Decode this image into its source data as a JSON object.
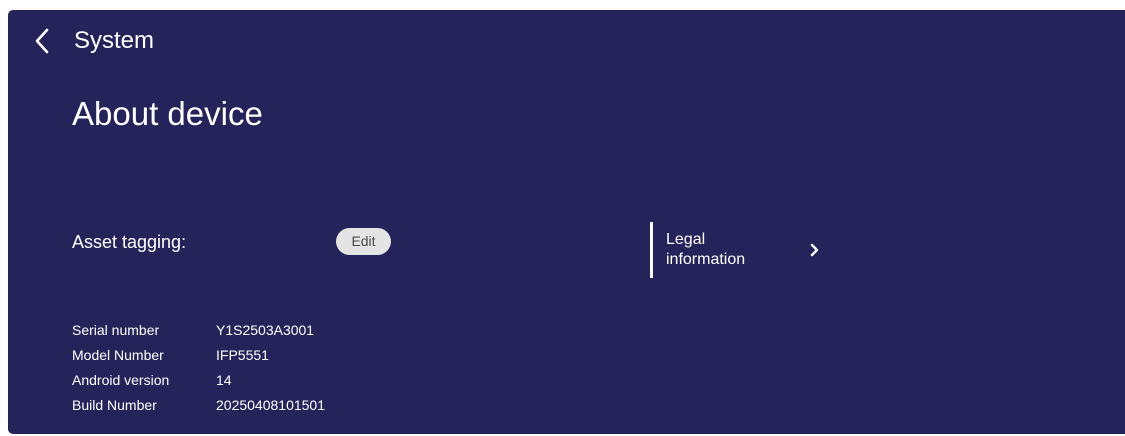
{
  "header": {
    "back_icon": "chevron-left-icon",
    "section_title": "System"
  },
  "page": {
    "title": "About device"
  },
  "asset_tagging": {
    "label": "Asset tagging:",
    "edit_label": "Edit"
  },
  "legal": {
    "line1": "Legal",
    "line2": "information",
    "chevron_icon": "chevron-right-icon"
  },
  "device_info": [
    {
      "label": "Serial number",
      "value": "Y1S2503A3001"
    },
    {
      "label": "Model Number",
      "value": "IFP5551"
    },
    {
      "label": "Android version",
      "value": "14"
    },
    {
      "label": "Build Number",
      "value": "20250408101501"
    }
  ],
  "colors": {
    "background": "#24245a",
    "text": "#ffffff",
    "button_bg": "#e4e4e4",
    "button_text": "#4a4a4a"
  }
}
